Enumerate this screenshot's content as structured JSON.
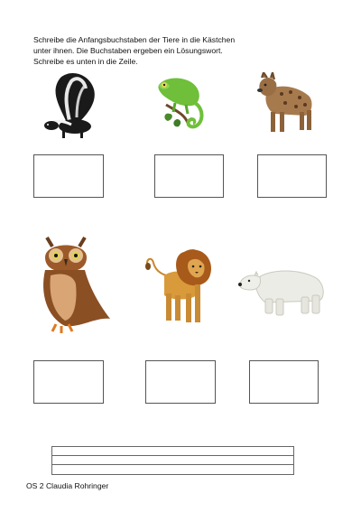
{
  "worksheet": {
    "instruction": "Schreibe die Anfangsbuchstaben der Tiere in die Kästchen unter ihnen. Die Buchstaben ergeben ein Lösungswort. Schreibe es unten in die Zeile.",
    "footer": "OS 2 Claudia Rohringer"
  },
  "animals": [
    {
      "icon": "skunk-icon"
    },
    {
      "icon": "chameleon-icon"
    },
    {
      "icon": "hyena-icon"
    },
    {
      "icon": "owl-icon"
    },
    {
      "icon": "lion-icon"
    },
    {
      "icon": "polar-bear-icon"
    }
  ],
  "letter_boxes": [
    "",
    "",
    "",
    "",
    "",
    ""
  ],
  "answer_line": ""
}
